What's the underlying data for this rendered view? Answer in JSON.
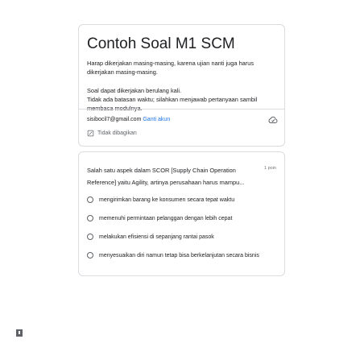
{
  "form": {
    "title": "Contoh Soal M1 SCM",
    "description_1": "Harap dikerjakan masing-masing, karena ujian nanti juga harus dikerjakan masing-masing.",
    "description_2": "Soal dapat dikerjakan berulang kali.\nTidak ada batasan waktu; silahkan menjawab pertanyaan sambil membaca modulnya.",
    "account_email": "sisibocil7@gmail.com",
    "switch_account": "Ganti akun",
    "share_status": "Tidak dibagikan"
  },
  "question": {
    "text": "Salah satu aspek dalam SCOR [Supply Chain Operation Reference] yaitu Agility, artinya perusahaan harus mampu...",
    "points": "1 poin",
    "options": [
      "mengirimkan barang ke konsumen secara tepat waktu",
      "memenuhi permintaan pelanggan dengan lebih cepat",
      "melakukan efisiensi di sepanjang rantai pasok",
      "menyesuaikan diri namun tetap bisa berkelanjutan secara bisnis"
    ]
  },
  "icons": {
    "cloud": "cloud-check-icon",
    "share": "no-share-icon",
    "corner": "report-icon"
  }
}
